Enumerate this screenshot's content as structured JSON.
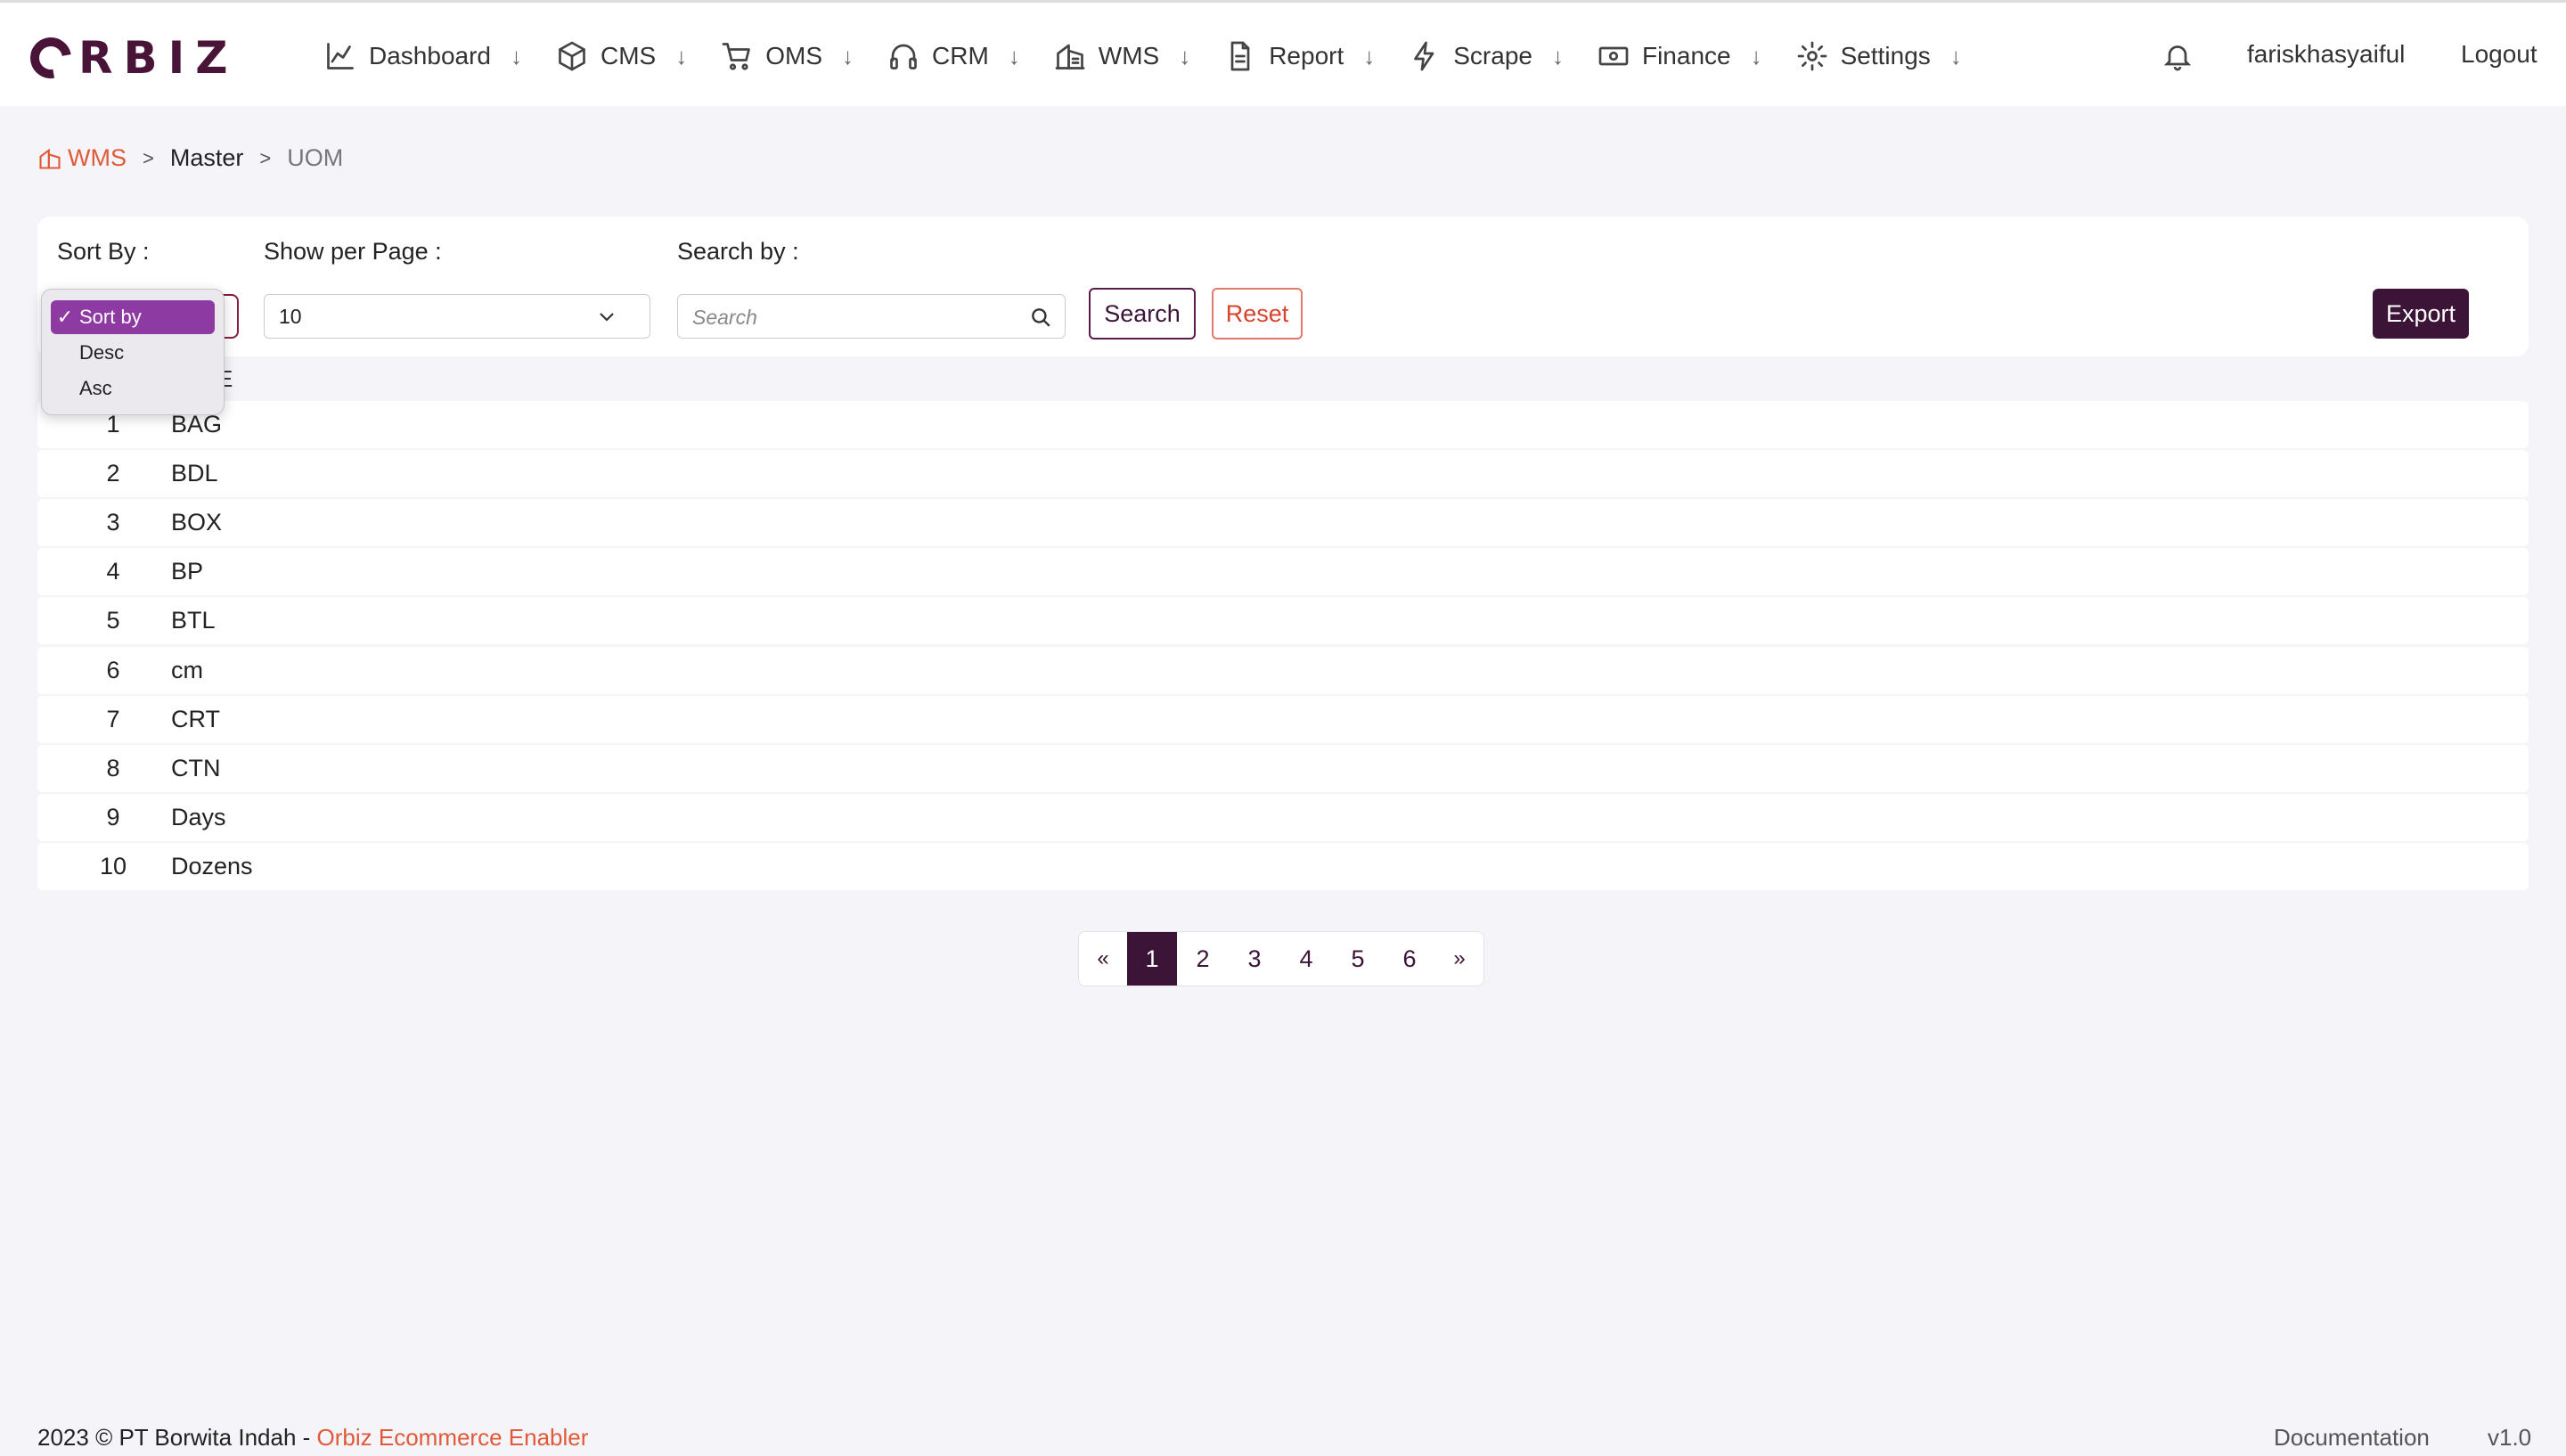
{
  "brand": {
    "logo_text": "RBIZ",
    "logo_full": "ORBIZ"
  },
  "nav": {
    "items": [
      {
        "label": "Dashboard",
        "icon": "chart-line-icon"
      },
      {
        "label": "CMS",
        "icon": "box-icon"
      },
      {
        "label": "OMS",
        "icon": "cart-icon"
      },
      {
        "label": "CRM",
        "icon": "headphones-icon"
      },
      {
        "label": "WMS",
        "icon": "warehouse-icon"
      },
      {
        "label": "Report",
        "icon": "document-icon"
      },
      {
        "label": "Scrape",
        "icon": "bolt-icon"
      },
      {
        "label": "Finance",
        "icon": "cash-icon"
      },
      {
        "label": "Settings",
        "icon": "gear-icon"
      }
    ],
    "arrow": "↓",
    "username": "fariskhasyaiful",
    "logout": "Logout"
  },
  "breadcrumb": {
    "section": "WMS",
    "sep": ">",
    "master": "Master",
    "current": "UOM"
  },
  "filters": {
    "sort_label": "Sort By :",
    "perpage_label": "Show per Page :",
    "search_label": "Search by :",
    "perpage_value": "10",
    "search_placeholder": "Search",
    "search_button": "Search",
    "reset_button": "Reset",
    "export_button": "Export"
  },
  "sort_dropdown": {
    "check": "✓",
    "options": [
      "Sort by",
      "Desc",
      "Asc"
    ],
    "selected_index": 0
  },
  "table": {
    "header_partial": "E",
    "rows": [
      {
        "no": "1",
        "name": "BAG"
      },
      {
        "no": "2",
        "name": "BDL"
      },
      {
        "no": "3",
        "name": "BOX"
      },
      {
        "no": "4",
        "name": "BP"
      },
      {
        "no": "5",
        "name": "BTL"
      },
      {
        "no": "6",
        "name": "cm"
      },
      {
        "no": "7",
        "name": "CRT"
      },
      {
        "no": "8",
        "name": "CTN"
      },
      {
        "no": "9",
        "name": "Days"
      },
      {
        "no": "10",
        "name": "Dozens"
      }
    ]
  },
  "pagination": {
    "prev": "«",
    "pages": [
      "1",
      "2",
      "3",
      "4",
      "5",
      "6"
    ],
    "active": "1",
    "next": "»"
  },
  "footer": {
    "copyright": "2023 © PT Borwita Indah - ",
    "brand_link": "Orbiz Ecommerce Enabler",
    "documentation": "Documentation",
    "version": "v1.0"
  },
  "colors": {
    "primary": "#3c1437",
    "accent": "#e05a3a",
    "dropdown_selected": "#8d3aa3"
  }
}
